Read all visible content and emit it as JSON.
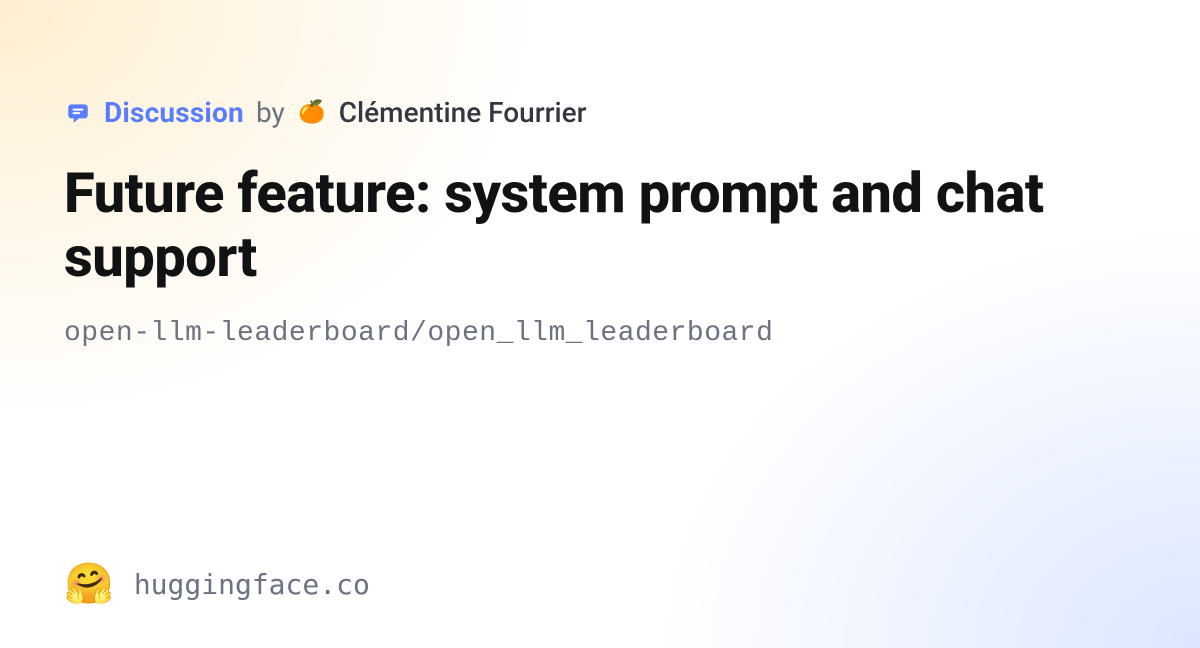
{
  "meta": {
    "discussion_label": "Discussion",
    "by_label": "by",
    "avatar_emoji": "🍊",
    "author_name": "Clémentine Fourrier"
  },
  "title": "Future feature: system prompt and chat support",
  "repo_path": "open-llm-leaderboard/open_llm_leaderboard",
  "footer": {
    "logo_emoji": "🤗",
    "domain": "huggingface.co"
  }
}
